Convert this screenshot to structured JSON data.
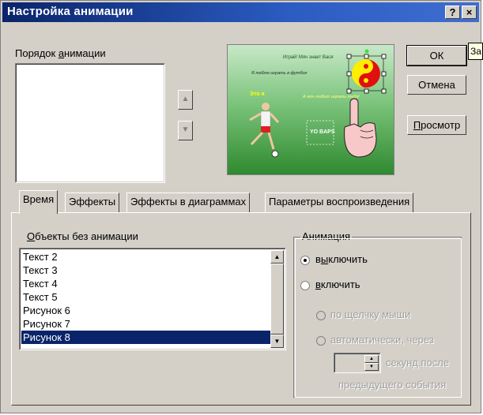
{
  "window": {
    "title": "Настройка анимации"
  },
  "titlebar_buttons": {
    "help": "?",
    "close": "×"
  },
  "tooltip": {
    "text": "За"
  },
  "order": {
    "label_pre": "Порядок ",
    "label_ul": "а",
    "label_post": "нимации"
  },
  "preview": {
    "line1": "Играй! Мяч знает Вася",
    "line2": "Я люблю играть в футбол",
    "line3": "Это я",
    "line4": "А мяч любит играть тебя!",
    "box_text": "YO BAPS"
  },
  "buttons": {
    "ok": "ОК",
    "cancel": "Отмена",
    "preview_pre": "",
    "preview_ul": "П",
    "preview_post": "росмотр"
  },
  "tabs": [
    {
      "label": "Время"
    },
    {
      "label": "Эффекты"
    },
    {
      "label": "Эффекты в диаграммах"
    },
    {
      "label": "Параметры воспроизведения"
    }
  ],
  "objects": {
    "label_ul": "О",
    "label_post": "бъекты без анимации",
    "items": [
      "Текст 2",
      "Текст 3",
      "Текст 4",
      "Текст 5",
      "Рисунок 6",
      "Рисунок 7",
      "Рисунок 8"
    ],
    "selected_index": 6
  },
  "animation": {
    "group_title": "Анимация",
    "off_pre": "в",
    "off_ul": "ы",
    "off_post": "ключить",
    "on_pre": "",
    "on_ul": "в",
    "on_post": "ключить",
    "on_click": "по щелчку мыши",
    "auto": "автоматически, через",
    "seconds_after": "секунд после",
    "prev_event": "предыдущего события",
    "selected": "off"
  }
}
